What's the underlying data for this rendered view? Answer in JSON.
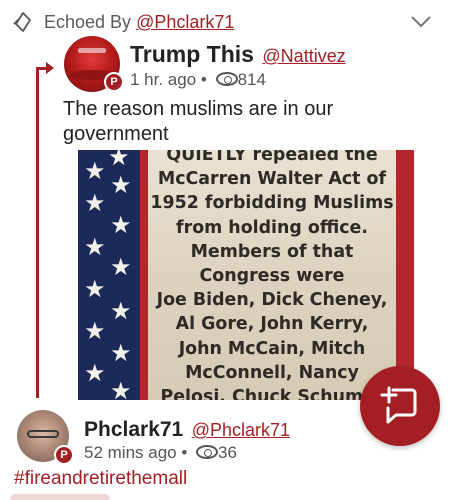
{
  "echo": {
    "label": "Echoed By ",
    "user": "@Phclark71"
  },
  "original_post": {
    "author_name": "Trump This",
    "author_handle": "@Nattivez",
    "time": "1 hr. ago",
    "separator": "•",
    "views": "814",
    "text": "The reason muslims are in our government",
    "badge": "P",
    "image_text": "QUIETLY repealed the\nMcCarren Walter Act of\n1952 forbidding Muslims\nfrom holding office.\nMembers of that\nCongress were\nJoe Biden, Dick Cheney,\nAl Gore, John Kerry,\nJohn McCain, Mitch\nMcConnell, Nancy\nPelosi, Chuck Schumer"
  },
  "reply_post": {
    "author_name": "Phclark71",
    "author_handle": "@Phclark71",
    "time": "52 mins ago",
    "separator": "•",
    "views": "36",
    "badge": "P",
    "hashtag": "#fireandretirethemall"
  },
  "icons": {
    "echo": "echo-icon",
    "chevron": "chevron-down-icon",
    "views": "eye-icon",
    "compose": "compose-icon"
  },
  "colors": {
    "accent": "#a31f24",
    "text": "#222222",
    "muted": "#555555"
  }
}
